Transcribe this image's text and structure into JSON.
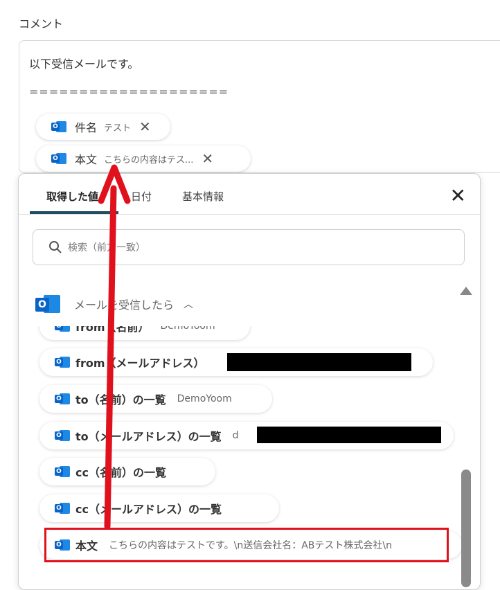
{
  "section_label": "コメント",
  "comment": {
    "line1": "以下受信メールです。",
    "line2": "===================="
  },
  "chips": [
    {
      "name": "件名",
      "value": "テスト",
      "close": "✕"
    },
    {
      "name": "本文",
      "value": "こちらの内容はテス...",
      "close": "✕"
    }
  ],
  "popup": {
    "tabs": [
      "取得した値",
      "日付",
      "基本情報"
    ],
    "close": "✕",
    "search_placeholder": "検索（前方一致）",
    "group_title": "メールを受信したら",
    "group_caret": "︿",
    "items": [
      {
        "name": "from（名前）",
        "value": "DemoYoom"
      },
      {
        "name": "from（メールアドレス）",
        "value": ""
      },
      {
        "name": "to（名前）の一覧",
        "value": "DemoYoom"
      },
      {
        "name": "to（メールアドレス）の一覧",
        "value": "d"
      },
      {
        "name": "cc（名前）の一覧",
        "value": ""
      },
      {
        "name": "cc（メールアドレス）の一覧",
        "value": ""
      },
      {
        "name": "本文",
        "value": "こちらの内容はテストです。\\n送信会社名：ABテスト株式会社\\n"
      }
    ]
  },
  "colors": {
    "highlight": "#e0101c",
    "tab_underline": "#1f4e5f",
    "outlook": "#0a64c8"
  }
}
